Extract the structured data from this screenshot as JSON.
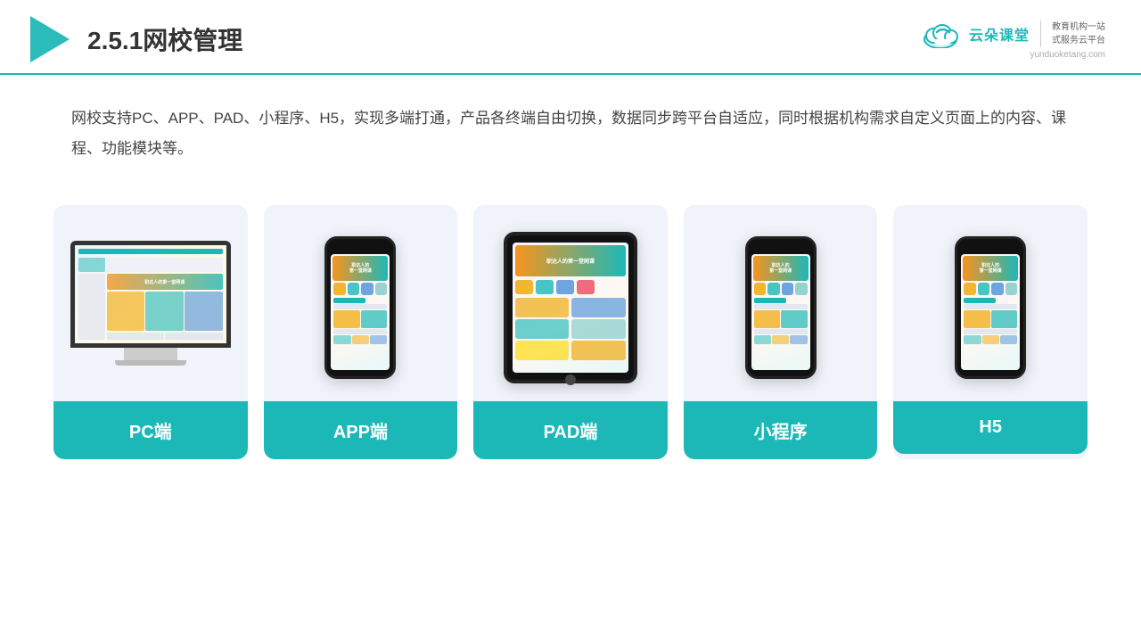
{
  "header": {
    "title": "2.5.1网校管理",
    "logo_name": "云朵课堂",
    "logo_url": "yunduoketang.com",
    "logo_tagline": "教育机构一站\n式服务云平台"
  },
  "description": {
    "text": "网校支持PC、APP、PAD、小程序、H5，实现多端打通，产品各终端自由切换，数据同步跨平台自适应，同时根据机构需求自定义页面上的内容、课程、功能模块等。"
  },
  "cards": [
    {
      "id": "pc",
      "label": "PC端",
      "type": "pc"
    },
    {
      "id": "app",
      "label": "APP端",
      "type": "phone"
    },
    {
      "id": "pad",
      "label": "PAD端",
      "type": "tablet"
    },
    {
      "id": "miniapp",
      "label": "小程序",
      "type": "phone"
    },
    {
      "id": "h5",
      "label": "H5",
      "type": "phone"
    }
  ],
  "colors": {
    "teal": "#1cb8b8",
    "accent": "#f7941d",
    "bg_card": "#f0f4fa",
    "text_dark": "#333",
    "text_mid": "#444"
  }
}
